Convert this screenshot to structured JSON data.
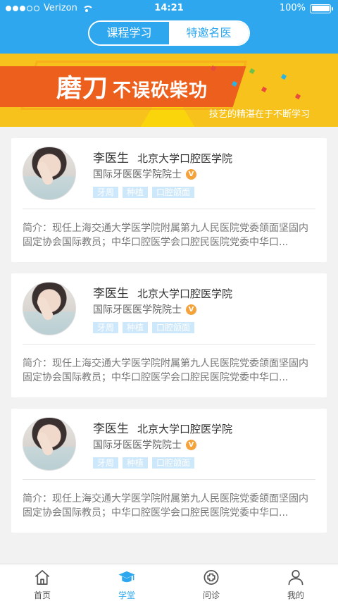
{
  "status_bar": {
    "carrier": "Verizon",
    "time": "14:21",
    "battery": "100%",
    "signal_bars_filled": 3,
    "signal_bars_total": 5
  },
  "segment": {
    "tabs": [
      {
        "label": "课程学习",
        "active": true
      },
      {
        "label": "特邀名医",
        "active": false
      }
    ]
  },
  "banner": {
    "headline_big": "磨刀",
    "headline_rest": "不误砍柴功",
    "tagline": "技艺的精湛在于不断学习"
  },
  "doctors": [
    {
      "name": "李医生",
      "hospital": "北京大学口腔医学院",
      "title": "国际牙医医学院院士",
      "badge": "V",
      "tags": [
        "牙周",
        "种植",
        "口腔颌面"
      ],
      "intro": "简介：现任上海交通大学医学院附属第九人民医院党委颌面坚固内固定协会国际教员；中华口腔医学会口腔民医院党委中华口..."
    },
    {
      "name": "李医生",
      "hospital": "北京大学口腔医学院",
      "title": "国际牙医医学院院士",
      "badge": "V",
      "tags": [
        "牙周",
        "种植",
        "口腔颌面"
      ],
      "intro": "简介：现任上海交通大学医学院附属第九人民医院党委颌面坚固内固定协会国际教员；中华口腔医学会口腔民医院党委中华口..."
    },
    {
      "name": "李医生",
      "hospital": "北京大学口腔医学院",
      "title": "国际牙医医学院院士",
      "badge": "V",
      "tags": [
        "牙周",
        "种植",
        "口腔颌面"
      ],
      "intro": "简介：现任上海交通大学医学院附属第九人民医院党委颌面坚固内固定协会国际教员；中华口腔医学会口腔民医院党委中华口..."
    }
  ],
  "tabbar": {
    "items": [
      {
        "label": "首页",
        "icon": "home-icon",
        "active": false
      },
      {
        "label": "学堂",
        "icon": "graduation-cap-icon",
        "active": true
      },
      {
        "label": "问诊",
        "icon": "medical-cross-icon",
        "active": false
      },
      {
        "label": "我的",
        "icon": "person-icon",
        "active": false
      }
    ]
  },
  "colors": {
    "primary": "#2ea7ef",
    "banner_yellow": "#f6c21b",
    "banner_orange": "#ec5f1d",
    "badge_orange": "#f6a23a",
    "tag_bg": "#cde8fb"
  }
}
